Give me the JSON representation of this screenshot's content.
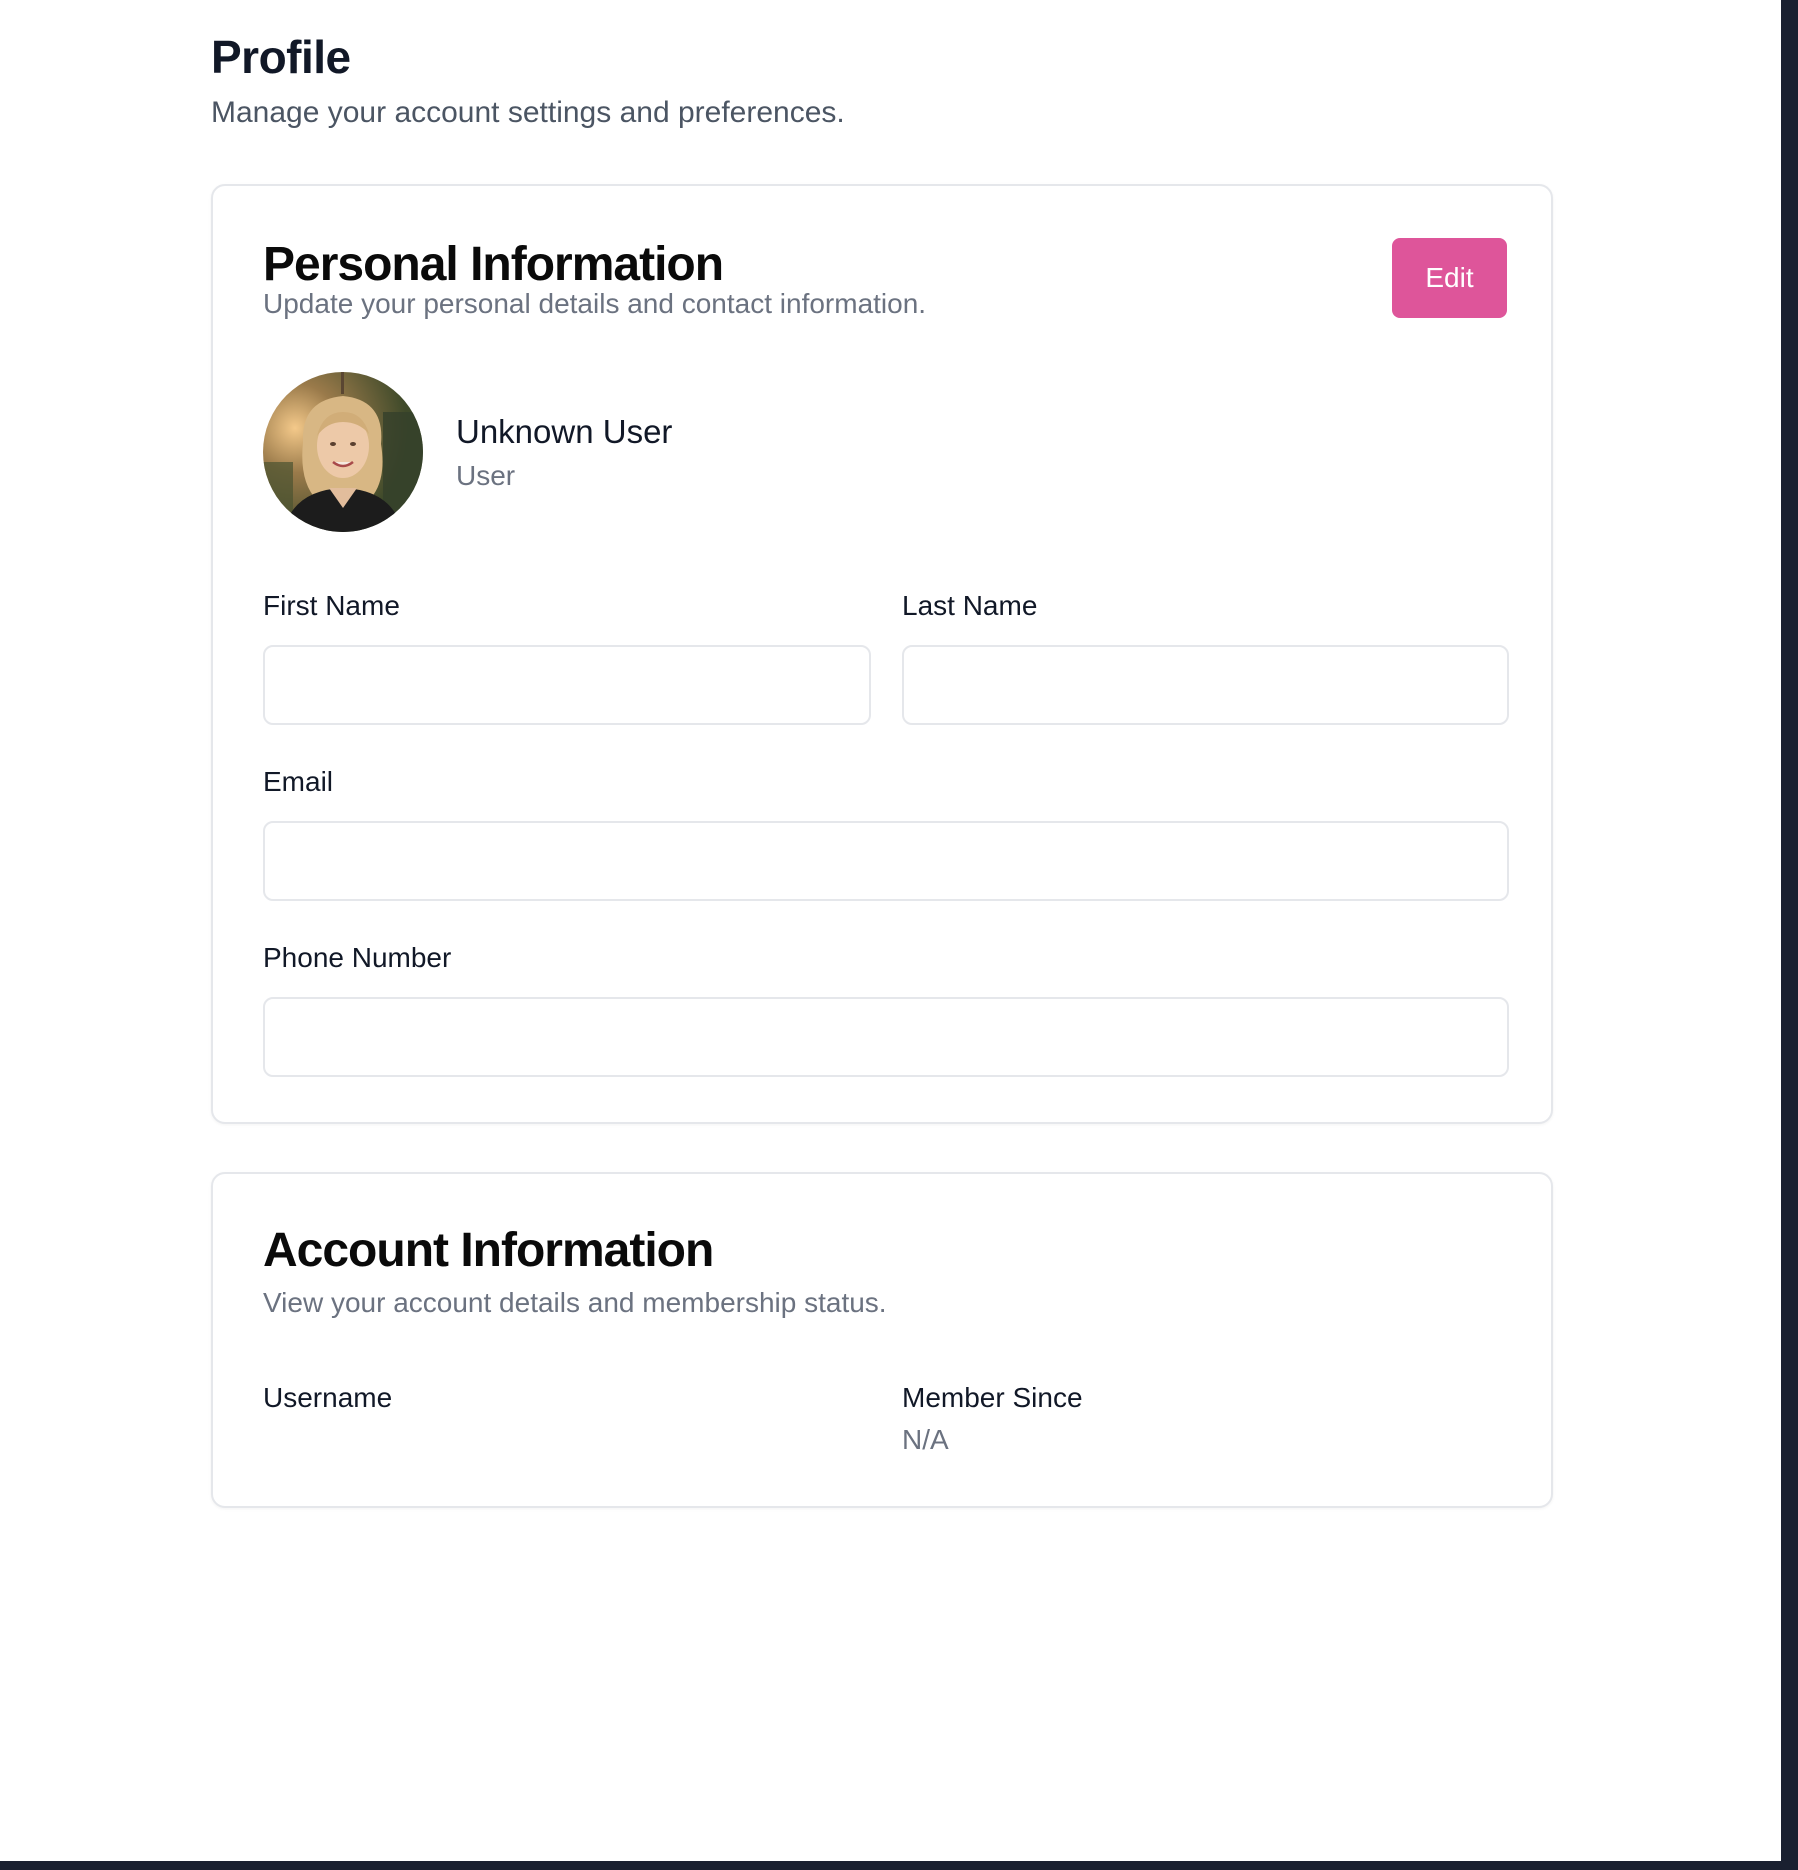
{
  "header": {
    "title": "Profile",
    "subtitle": "Manage your account settings and preferences."
  },
  "personal": {
    "title": "Personal Information",
    "description": "Update your personal details and contact information.",
    "edit_label": "Edit",
    "user_name": "Unknown User",
    "user_role": "User",
    "fields": {
      "first_name": {
        "label": "First Name",
        "value": ""
      },
      "last_name": {
        "label": "Last Name",
        "value": ""
      },
      "email": {
        "label": "Email",
        "value": ""
      },
      "phone": {
        "label": "Phone Number",
        "value": ""
      }
    }
  },
  "account": {
    "title": "Account Information",
    "description": "View your account details and membership status.",
    "username_label": "Username",
    "username_value": "",
    "member_since_label": "Member Since",
    "member_since_value": "N/A"
  },
  "colors": {
    "accent": "#de559a",
    "background_frame": "#1a2030"
  }
}
